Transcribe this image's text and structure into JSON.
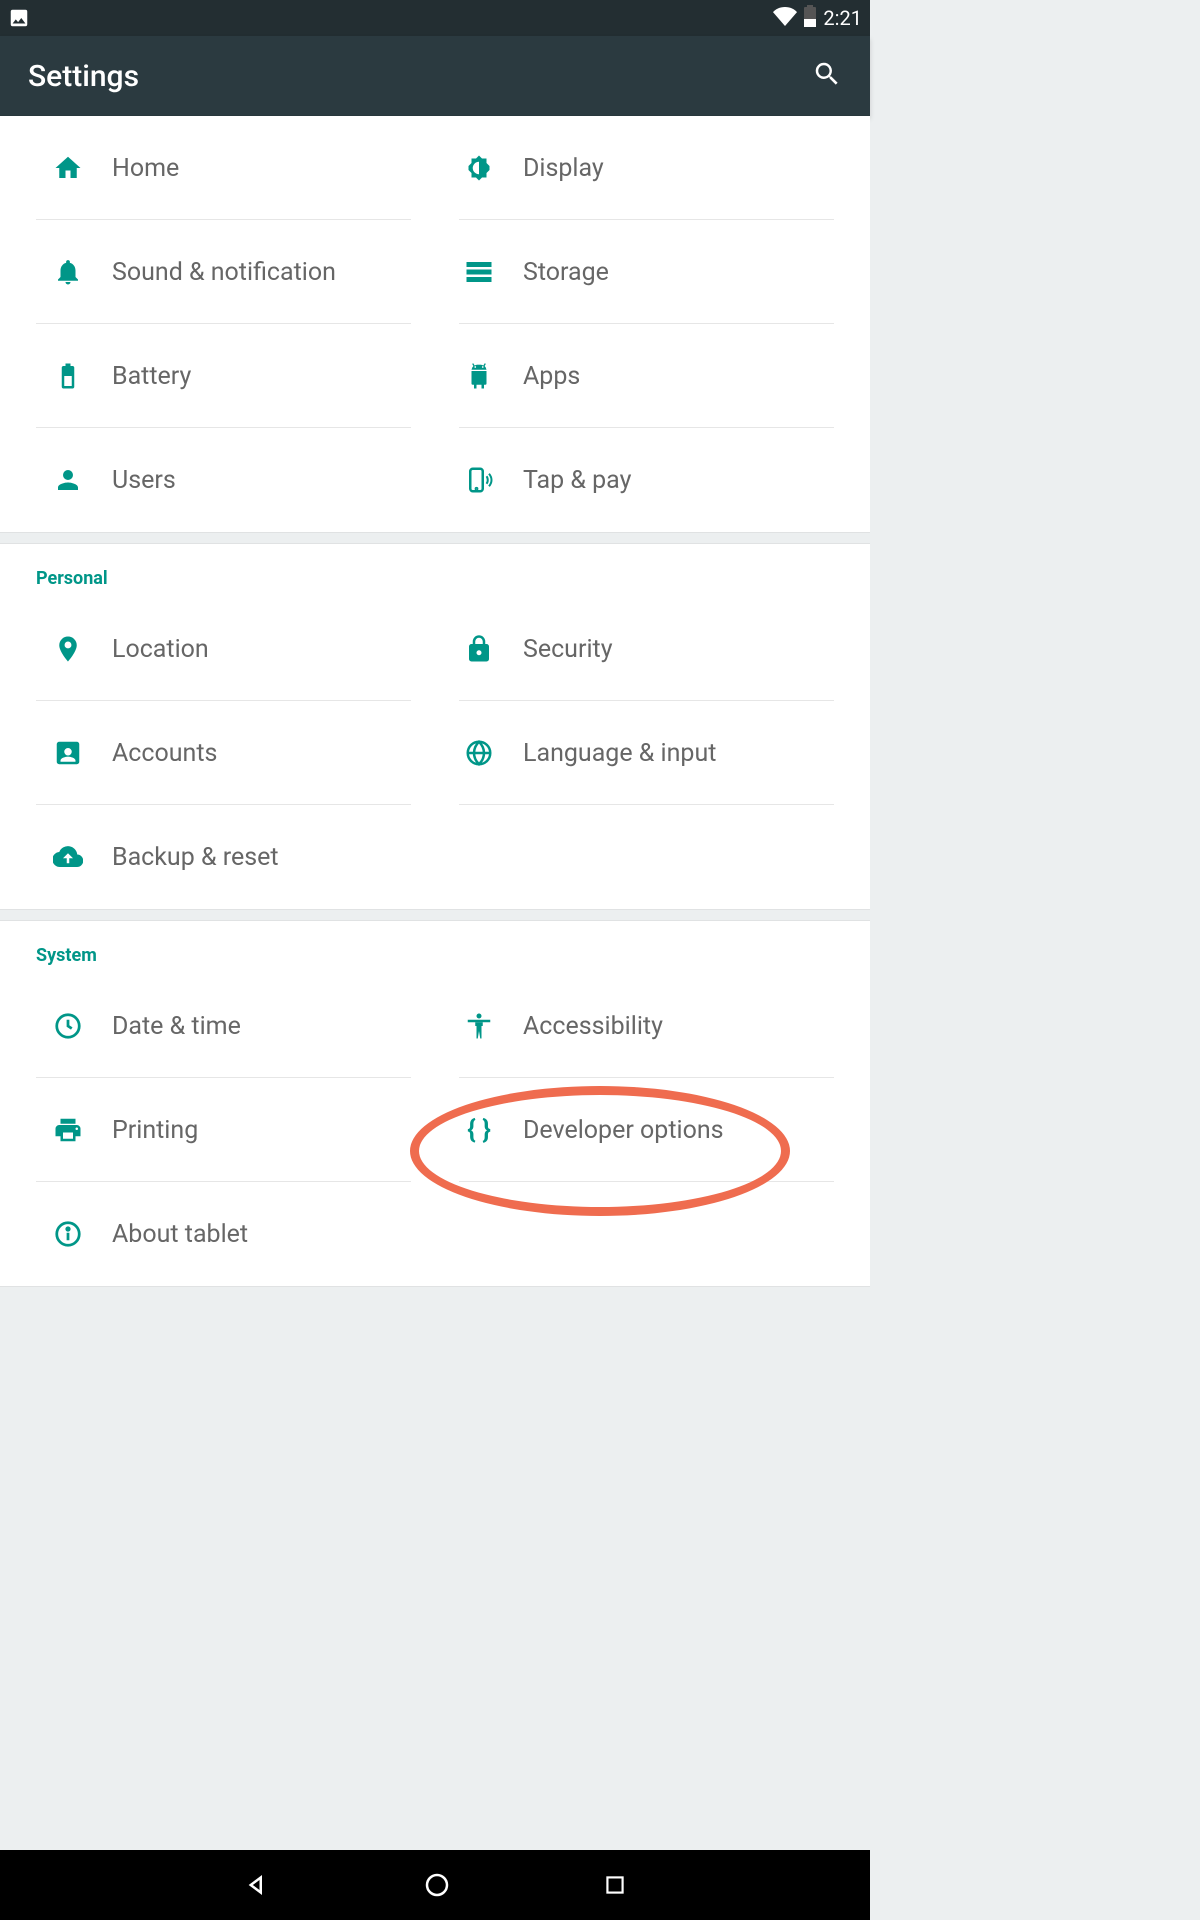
{
  "statusbar": {
    "time": "2:21"
  },
  "appbar": {
    "title": "Settings"
  },
  "sections": {
    "device": {
      "home": "Home",
      "display": "Display",
      "sound": "Sound & notification",
      "storage": "Storage",
      "battery": "Battery",
      "apps": "Apps",
      "users": "Users",
      "tap_pay": "Tap & pay"
    },
    "personal": {
      "header": "Personal",
      "location": "Location",
      "security": "Security",
      "accounts": "Accounts",
      "language": "Language & input",
      "backup": "Backup & reset"
    },
    "system": {
      "header": "System",
      "date_time": "Date & time",
      "accessibility": "Accessibility",
      "printing": "Printing",
      "developer": "Developer options",
      "about": "About tablet"
    }
  },
  "colors": {
    "accent": "#009688",
    "text": "#666",
    "highlight": "#ef6c4f"
  }
}
